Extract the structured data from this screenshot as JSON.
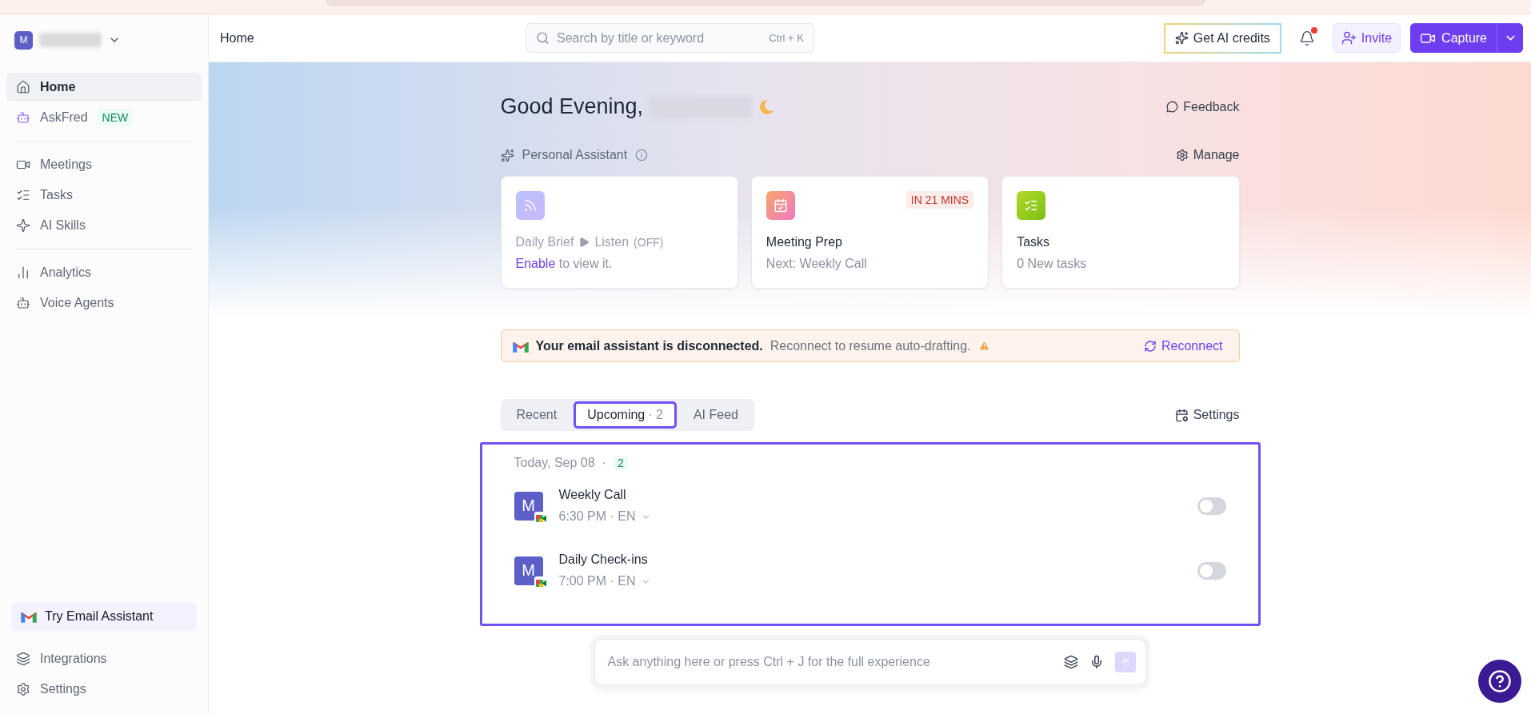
{
  "top_bar": {
    "breadcrumb": "Home",
    "search": {
      "placeholder": "Search by title or keyword",
      "shortcut": "Ctrl + K"
    },
    "ai_credits": "Get AI credits",
    "notifications": {
      "unread": true
    },
    "invite": "Invite",
    "capture": "Capture"
  },
  "sidebar": {
    "workspace": {
      "initial": "M"
    },
    "groups": [
      [
        {
          "label": "Home",
          "selected": true
        },
        {
          "label": "AskFred",
          "badge": "NEW",
          "selected": false
        }
      ],
      [
        {
          "label": "Meetings",
          "selected": false
        },
        {
          "label": "Tasks",
          "selected": false
        },
        {
          "label": "AI Skills",
          "selected": false
        }
      ],
      [
        {
          "label": "Analytics",
          "selected": false
        },
        {
          "label": "Voice Agents",
          "selected": false
        }
      ]
    ],
    "promo": "Try Email Assistant",
    "footer": [
      {
        "label": "Integrations"
      },
      {
        "label": "Settings"
      }
    ]
  },
  "greeting": {
    "text": "Good Evening,",
    "feedback": "Feedback"
  },
  "assistant": {
    "title": "Personal Assistant",
    "manage": "Manage",
    "cards": [
      {
        "kind": "brief",
        "title": "Daily Brief",
        "action": "Listen",
        "status": "(OFF)",
        "link": "Enable",
        "text": " to view it."
      },
      {
        "kind": "meeting",
        "badge": "IN 21 MINS",
        "title": "Meeting Prep",
        "subtitle": "Next: Weekly Call"
      },
      {
        "kind": "tasks",
        "title": "Tasks",
        "subtitle": "0 New tasks"
      }
    ]
  },
  "banner": {
    "title": "Your email assistant is disconnected.",
    "message": "Reconnect to resume auto-drafting.",
    "action": "Reconnect"
  },
  "tabs": [
    {
      "label": "Recent",
      "selected": false
    },
    {
      "label": "Upcoming",
      "count": "· 2",
      "selected": true
    },
    {
      "label": "AI Feed",
      "selected": false
    }
  ],
  "calendar_settings": "Settings",
  "day": {
    "date": "Today, Sep 08",
    "separator": "·",
    "count": "2",
    "meetings": [
      {
        "avatar": "M",
        "title": "Weekly Call",
        "details": "6:30 PM · EN",
        "on": false
      },
      {
        "avatar": "M",
        "title": "Daily Check-ins",
        "details": "7:00 PM · EN",
        "on": false
      }
    ]
  },
  "ask": {
    "placeholder": "Ask anything here or press Ctrl + J for the full experience"
  }
}
